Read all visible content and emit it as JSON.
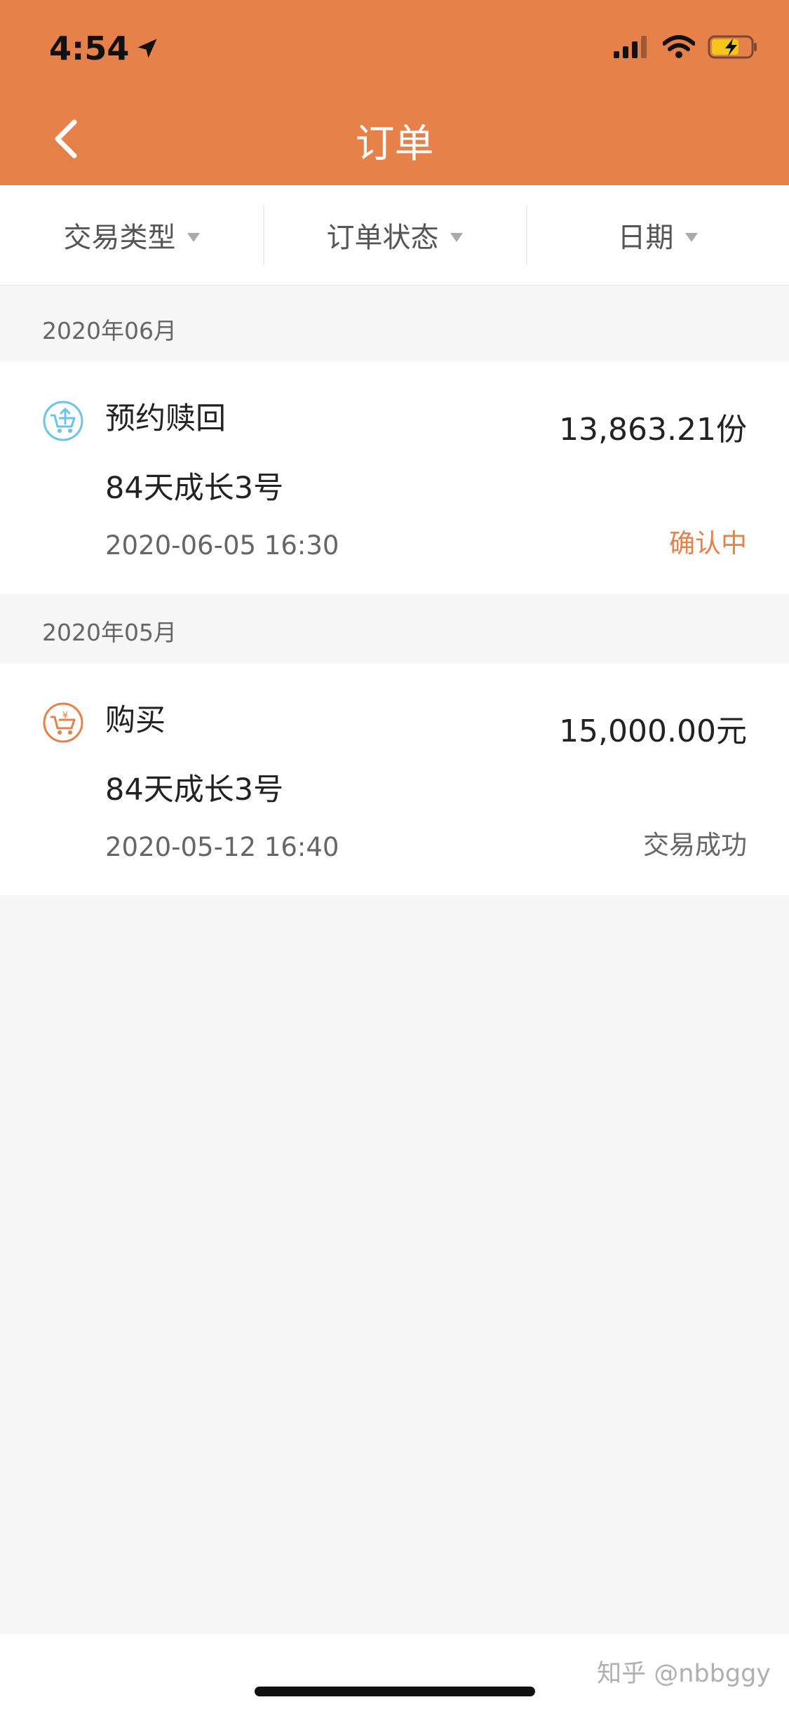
{
  "status_bar": {
    "time": "4:54"
  },
  "header": {
    "title": "订单"
  },
  "filters": [
    {
      "label": "交易类型"
    },
    {
      "label": "订单状态"
    },
    {
      "label": "日期"
    }
  ],
  "groups": [
    {
      "month": "2020年06月",
      "order": {
        "icon": "redeem-cart-icon",
        "type": "预约赎回",
        "product": "84天成长3号",
        "date": "2020-06-05 16:30",
        "amount": "13,863.21份",
        "status": "确认中",
        "status_color": "#e6814a"
      }
    },
    {
      "month": "2020年05月",
      "order": {
        "icon": "purchase-cart-icon",
        "type": "购买",
        "product": "84天成长3号",
        "date": "2020-05-12 16:40",
        "amount": "15,000.00元",
        "status": "交易成功",
        "status_color": "#666666"
      }
    }
  ],
  "watermark": "知乎 @nbbggy",
  "colors": {
    "accent": "#e6814a",
    "redeem_icon": "#6cc3ea",
    "purchase_icon": "#e6814a"
  }
}
